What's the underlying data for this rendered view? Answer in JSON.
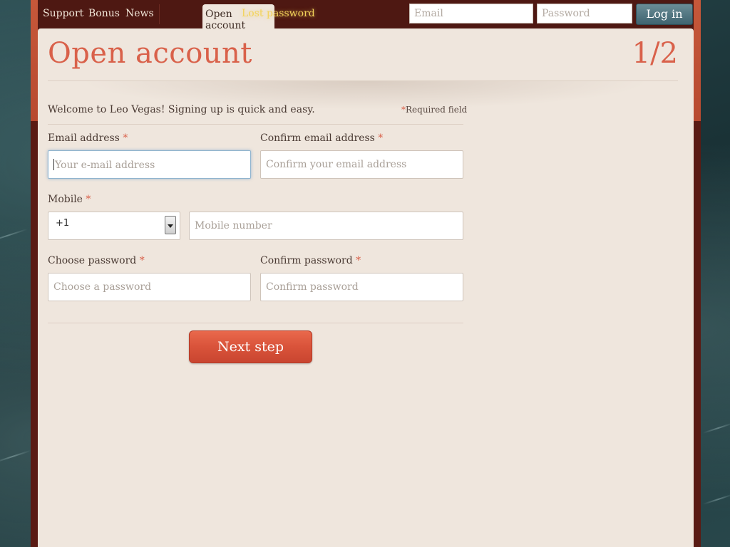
{
  "nav": {
    "links": [
      "Support",
      "Bonus",
      "News"
    ],
    "active_tab": "Open account",
    "lost_password": "Lost password"
  },
  "login": {
    "email_placeholder": "Email",
    "password_placeholder": "Password",
    "button": "Log in"
  },
  "page": {
    "title": "Open account",
    "step": "1/2",
    "welcome": "Welcome to Leo Vegas! Signing up is quick and easy.",
    "required_marker": "*",
    "required_text": "Required field"
  },
  "form": {
    "email": {
      "label": "Email address",
      "placeholder": "Your e-mail address"
    },
    "confirm_email": {
      "label": "Confirm email address",
      "placeholder": "Confirm your email address"
    },
    "mobile": {
      "label": "Mobile",
      "prefix": "+1",
      "placeholder": "Mobile number"
    },
    "password": {
      "label": "Choose password",
      "placeholder": "Choose a password"
    },
    "confirm_password": {
      "label": "Confirm password",
      "placeholder": "Confirm password"
    },
    "required_star": "*",
    "submit": "Next step"
  },
  "colors": {
    "accent": "#d9614a",
    "frame": "#5a1b14",
    "panel": "#efe6dd",
    "login_button": "#4f7480",
    "highlight": "#f3d35a"
  }
}
